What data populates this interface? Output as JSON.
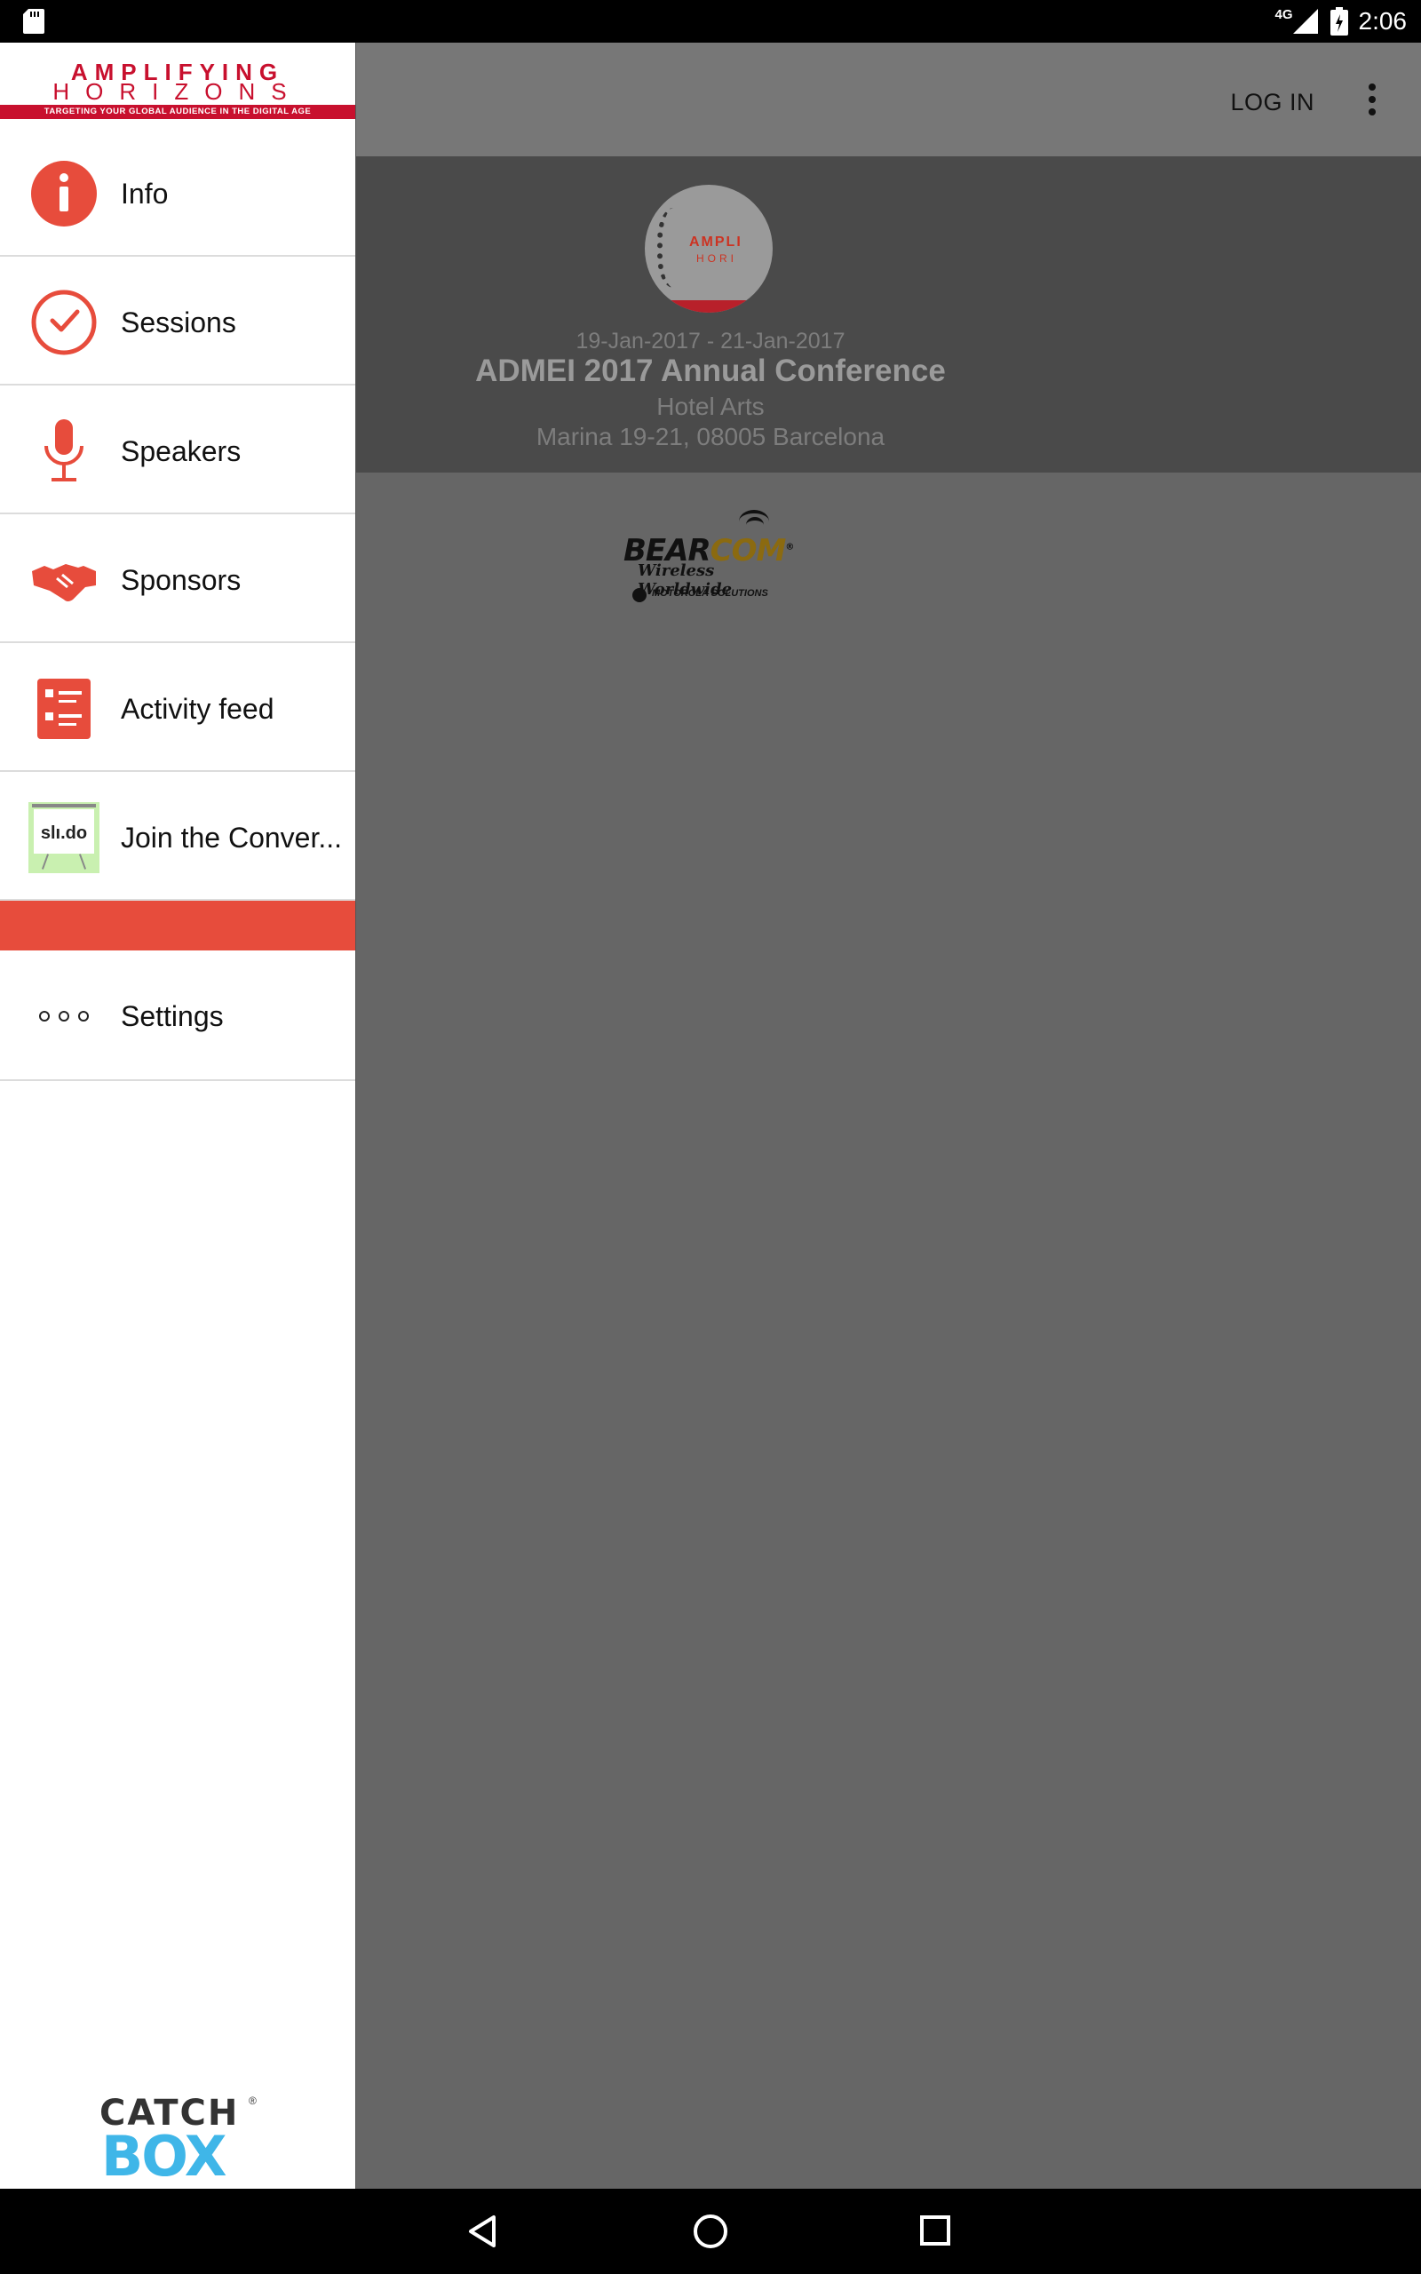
{
  "status_bar": {
    "network": "4G",
    "time": "2:06",
    "icons": [
      "sd-card-icon",
      "signal-icon",
      "battery-icon"
    ]
  },
  "app_bar": {
    "login_label": "LOG IN",
    "overflow_icon": "more-vert-icon"
  },
  "hero": {
    "logo_text_1": "AMPLI",
    "logo_text_2": "HORI",
    "date": "19-Jan-2017 - 21-Jan-2017",
    "title": "ADMEI 2017 Annual Conference",
    "venue": "Hotel Arts",
    "address": "Marina 19-21, 08005 Barcelona"
  },
  "sponsor": {
    "bear": "BEAR",
    "com": "COM",
    "reg": "®",
    "tagline": "Wireless Worldwide",
    "partner": "MOTOROLA SOLUTIONS"
  },
  "drawer": {
    "brand": {
      "line1": "AMPLIFYING",
      "line2": "HORIZONS",
      "tagline": "TARGETING YOUR GLOBAL AUDIENCE IN THE DIGITAL AGE"
    },
    "items": [
      {
        "label": "Info",
        "icon": "info-icon"
      },
      {
        "label": "Sessions",
        "icon": "clock-check-icon"
      },
      {
        "label": "Speakers",
        "icon": "microphone-icon"
      },
      {
        "label": "Sponsors",
        "icon": "handshake-icon"
      },
      {
        "label": "Activity feed",
        "icon": "list-icon"
      },
      {
        "label": "Join the Conver...",
        "icon": "slido-icon"
      }
    ],
    "slido_text": "slı.do",
    "settings": {
      "label": "Settings",
      "icon": "more-horiz-icon"
    },
    "footer": {
      "line1": "CATCH",
      "reg": "®",
      "line2": "BOX"
    }
  },
  "colors": {
    "accent": "#e74c3c",
    "brand_red": "#c8102e",
    "catchbox_blue": "#3fb6e8"
  },
  "nav_bar": {
    "buttons": [
      "back-icon",
      "home-icon",
      "recents-icon"
    ]
  }
}
